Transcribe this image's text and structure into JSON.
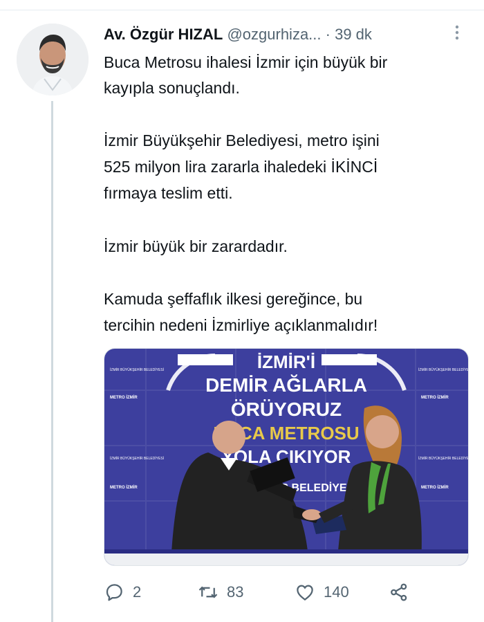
{
  "tweet": {
    "author_name": "Av. Özgür HIZAL",
    "handle": "@ozgurhiza...",
    "separator": "·",
    "time": "39 dk",
    "lines": [
      "Buca Metrosu ihalesi İzmir için büyük bir",
      "kayıpla sonuçlandı.",
      "İzmir Büyükşehir Belediyesi, metro işini",
      "525 milyon lira zararla ihaledeki İKİNCİ",
      "fırmaya teslim etti.",
      "İzmir büyük bir zarardadır.",
      "Kamuda şeffaflık ilkesi gereğince, bu",
      "tercihin nedeni İzmirliye açıklanmalıdır!"
    ]
  },
  "media": {
    "banner_line1": "İZMİR'İ",
    "banner_line2": "DEMİR AĞLARLA",
    "banner_line3": "ÖRÜYORUZ",
    "banner_line4": "BUCA METROSU",
    "banner_line5": "YOLA ÇIKIYOR",
    "banner_line6": "BÜYÜKŞEHİR BELEDİYESİ",
    "logo_text": "İZMİR BÜYÜKŞEHİR BELEDİYESİ",
    "metro_sign": "METRO İZMİR"
  },
  "actions": {
    "replies": "2",
    "retweets": "83",
    "likes": "140"
  },
  "colors": {
    "text": "#0f1419",
    "secondary": "#536471",
    "banner_bg": "#3d3f9e"
  }
}
